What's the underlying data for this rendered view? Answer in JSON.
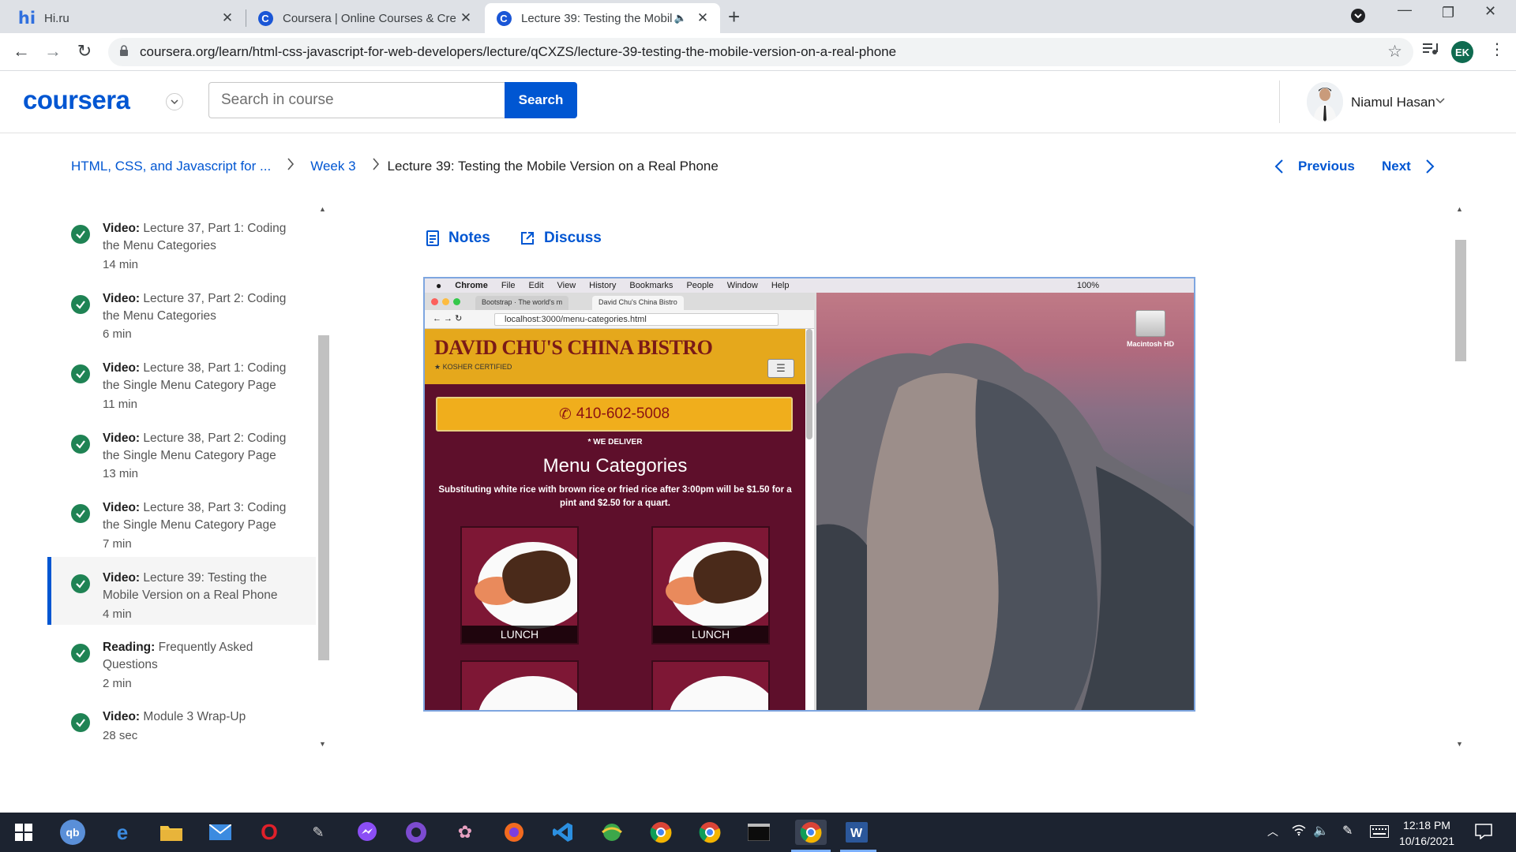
{
  "browser": {
    "tabs": [
      {
        "title": "Hi.ru",
        "favicon": "hi-favicon"
      },
      {
        "title": "Coursera | Online Courses & Cre",
        "favicon": "coursera-favicon"
      },
      {
        "title": "Lecture 39: Testing the Mobil",
        "favicon": "coursera-favicon",
        "active": true
      }
    ],
    "url": "coursera.org/learn/html-css-javascript-for-web-developers/lecture/qCXZS/lecture-39-testing-the-mobile-version-on-a-real-phone",
    "profile_initials": "EK"
  },
  "header": {
    "logo": "coursera",
    "search_placeholder": "Search in course",
    "search_button": "Search",
    "user_name": "Niamul Hasan"
  },
  "breadcrumb": {
    "course": "HTML, CSS, and Javascript for ...",
    "week": "Week 3",
    "current": "Lecture 39: Testing the Mobile Version on a Real Phone"
  },
  "pager": {
    "previous": "Previous",
    "next": "Next"
  },
  "sidebar": {
    "items": [
      {
        "type": "Video:",
        "title": "Lecture 37, Part 1: Coding the Menu Categories",
        "duration": "14 min",
        "completed": true
      },
      {
        "type": "Video:",
        "title": "Lecture 37, Part 2: Coding the Menu Categories",
        "duration": "6 min",
        "completed": true
      },
      {
        "type": "Video:",
        "title": "Lecture 38, Part 1: Coding the Single Menu Category Page",
        "duration": "11 min",
        "completed": true
      },
      {
        "type": "Video:",
        "title": "Lecture 38, Part 2: Coding the Single Menu Category Page",
        "duration": "13 min",
        "completed": true
      },
      {
        "type": "Video:",
        "title": "Lecture 38, Part 3: Coding the Single Menu Category Page",
        "duration": "7 min",
        "completed": true
      },
      {
        "type": "Video:",
        "title": "Lecture 39: Testing the Mobile Version on a Real Phone",
        "duration": "4 min",
        "completed": true,
        "current": true
      },
      {
        "type": "Reading:",
        "title": "Frequently Asked Questions",
        "duration": "2 min",
        "completed": true
      },
      {
        "type": "Video:",
        "title": "Module 3 Wrap-Up",
        "duration": "28 sec",
        "completed": true
      }
    ]
  },
  "tools": {
    "notes": "Notes",
    "discuss": "Discuss"
  },
  "video": {
    "mac_menu": [
      "Chrome",
      "File",
      "Edit",
      "View",
      "History",
      "Bookmarks",
      "People",
      "Window",
      "Help"
    ],
    "mac_status": "100%",
    "disk_label": "Macintosh HD",
    "inner_tabs": [
      "Bootstrap · The world's m",
      "David Chu's China Bistro"
    ],
    "inner_url": "localhost:3000/menu-categories.html",
    "site_title": "DAVID CHU'S CHINA BISTRO",
    "kosher": "KOSHER CERTIFIED",
    "phone": "410-602-5008",
    "deliver": "* WE DELIVER",
    "menu_title": "Menu Categories",
    "menu_sub": "Substituting white rice with brown rice or fried rice after 3:00pm will be $1.50 for a pint and $2.50 for a quart.",
    "tiles": [
      "LUNCH",
      "LUNCH"
    ]
  },
  "taskbar": {
    "time": "12:18 PM",
    "date": "10/16/2021"
  }
}
